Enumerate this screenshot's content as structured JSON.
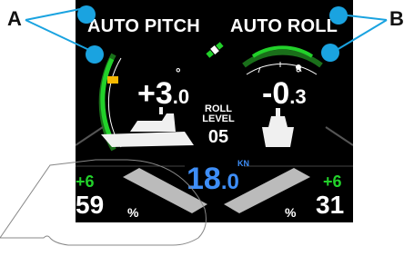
{
  "callouts": {
    "a": "A",
    "b": "B"
  },
  "pitch": {
    "title": "AUTO PITCH",
    "int": "+3",
    "dec": ".0",
    "deg": "°"
  },
  "roll": {
    "title": "AUTO ROLL",
    "int": "-0",
    "dec": ".3",
    "deg": "°"
  },
  "roll_level": {
    "line1": "ROLL",
    "line2": "LEVEL",
    "value": "05"
  },
  "speed": {
    "int": "18",
    "dec": ".0",
    "unit": "KN"
  },
  "left_trim": {
    "delta": "+6",
    "value": "59",
    "unit": "%"
  },
  "right_trim": {
    "delta": "+6",
    "value": "31",
    "unit": "%"
  },
  "colors": {
    "accent_green": "#22d12a",
    "speed_blue": "#3e8ef7",
    "callout_blue": "#1aa3e0",
    "indicator": "#f5b800"
  },
  "icons": [
    "satellite-icon",
    "boat-side-icon",
    "boat-rear-icon"
  ]
}
